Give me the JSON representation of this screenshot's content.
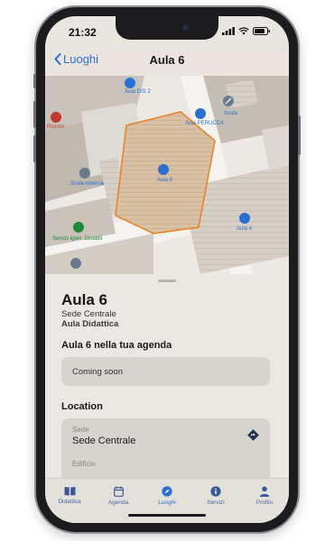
{
  "status_bar": {
    "time": "21:32"
  },
  "nav": {
    "back_label": "Luoghi",
    "title": "Aula 6"
  },
  "map": {
    "labels": {
      "aula_dis2": "Aula DIS 2",
      "aula_peruca": "Aula PERUCCA",
      "scala": "Scala",
      "ristoro": "Ristoro",
      "aula6": "Aula 6",
      "scala_esterna": "Scala esterna",
      "aula4": "Aula 4",
      "servizi_igienici": "Servizi igien. Disabili"
    },
    "colors": {
      "highlight": "#e8852a",
      "pin": "#2a6fd1",
      "building": "#c8c2ba",
      "street": "#f4f2ef"
    }
  },
  "sheet": {
    "title": "Aula 6",
    "subtitle": "Sede Centrale",
    "type": "Aula Didattica",
    "agenda_title": "Aula 6 nella tua agenda",
    "agenda_card_text": "Coming soon",
    "location_title": "Location",
    "site_label": "Sede",
    "site_value": "Sede Centrale",
    "building_label": "Edificio"
  },
  "tabs": [
    {
      "label": "Didattica",
      "icon": "book-icon"
    },
    {
      "label": "Agenda",
      "icon": "calendar-icon"
    },
    {
      "label": "Luoghi",
      "icon": "compass-icon",
      "active": true
    },
    {
      "label": "Servizi",
      "icon": "info-icon"
    },
    {
      "label": "Profilo",
      "icon": "person-icon"
    }
  ],
  "theme": {
    "accent": "#2d6fd4"
  }
}
